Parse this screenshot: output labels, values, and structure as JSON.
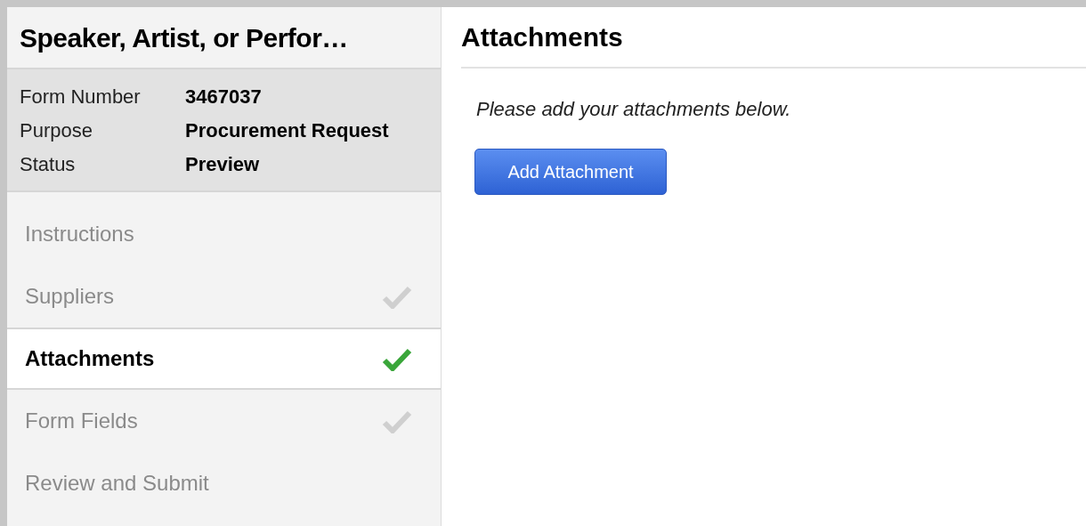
{
  "sidebar": {
    "title": "Speaker, Artist, or Perfor…",
    "details": [
      {
        "label": "Form Number",
        "value": "3467037"
      },
      {
        "label": "Purpose",
        "value": "Procurement Request"
      },
      {
        "label": "Status",
        "value": "Preview"
      }
    ],
    "steps": [
      {
        "label": "Instructions",
        "selected": false,
        "completed": false
      },
      {
        "label": "Suppliers",
        "selected": false,
        "completed": true
      },
      {
        "label": "Attachments",
        "selected": true,
        "completed": true
      },
      {
        "label": "Form Fields",
        "selected": false,
        "completed": true
      },
      {
        "label": "Review and Submit",
        "selected": false,
        "completed": false
      }
    ]
  },
  "main": {
    "heading": "Attachments",
    "instruction": "Please add your attachments below.",
    "button": "Add Attachment"
  }
}
